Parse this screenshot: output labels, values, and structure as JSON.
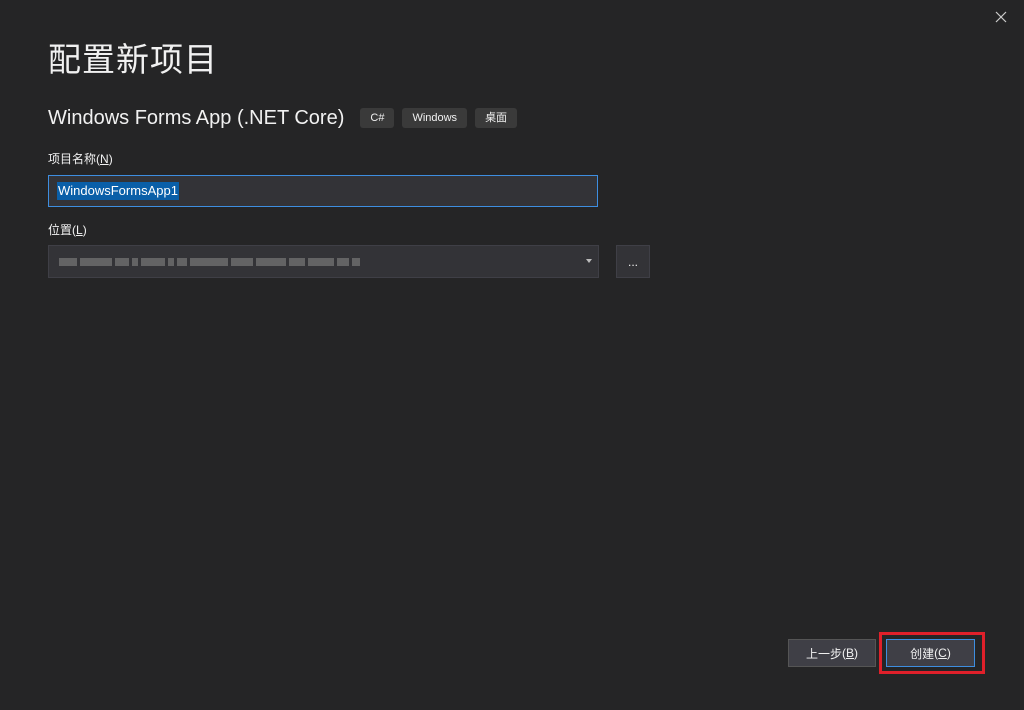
{
  "dialog": {
    "title": "配置新项目",
    "template_name": "Windows Forms App (.NET Core)",
    "tags": [
      "C#",
      "Windows",
      "桌面"
    ]
  },
  "project_name": {
    "label": "项目名称",
    "accesskey": "N",
    "value": "WindowsFormsApp1"
  },
  "location": {
    "label": "位置",
    "accesskey": "L",
    "value_blurred": true,
    "browse_label": "..."
  },
  "buttons": {
    "back_label": "上一步",
    "back_accesskey": "B",
    "create_label": "创建",
    "create_accesskey": "C"
  },
  "icons": {
    "close": "close-icon",
    "dropdown": "chevron-down-icon"
  },
  "colors": {
    "background": "#252526",
    "input_bg": "#333337",
    "focus_border": "#3e8ee0",
    "selection": "#0a5fa8",
    "highlight": "#e0202a"
  }
}
